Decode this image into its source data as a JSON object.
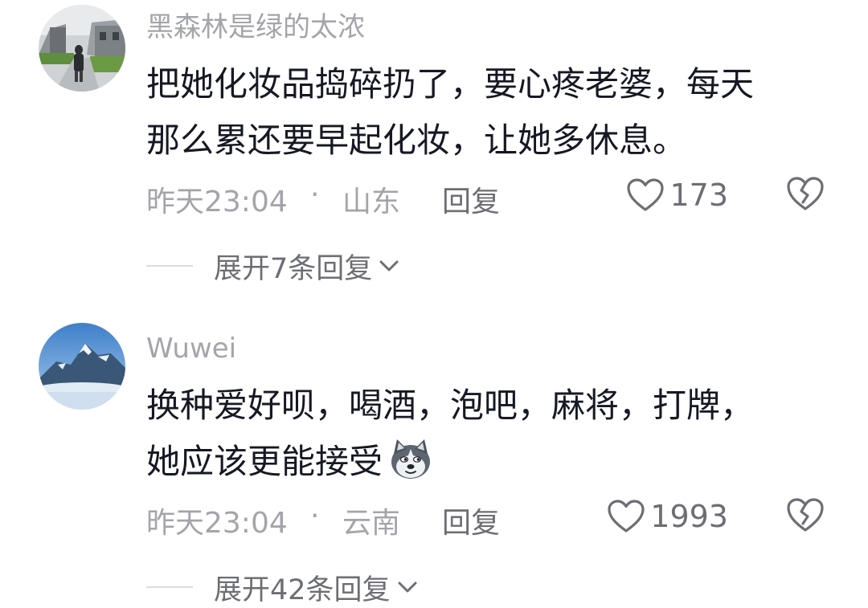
{
  "comments": [
    {
      "username": "黑森林是绿的太浓",
      "lines": [
        "把她化妆品捣碎扔了，要心疼老婆，每天",
        "那么累还要早起化妆，让她多休息。"
      ],
      "time": "昨天23:04",
      "separator": "·",
      "region": "山东",
      "reply_label": "回复",
      "likes": "173",
      "expand_label": "展开7条回复",
      "avatar": "person-on-path-photo"
    },
    {
      "username": "Wuwei",
      "lines": [
        "换种爱好呗，喝酒，泡吧，麻将，打牌，",
        "她应该更能接受"
      ],
      "emoji": "husky-dog-emoji",
      "time": "昨天23:04",
      "separator": "·",
      "region": "云南",
      "reply_label": "回复",
      "likes": "1993",
      "expand_label": "展开42条回复",
      "avatar": "snowy-mountain-photo"
    }
  ],
  "icons": {
    "like": "heart-outline-icon",
    "dislike": "broken-heart-icon",
    "expand": "chevron-down-icon"
  },
  "colors": {
    "text_primary": "#161823",
    "text_secondary": "#a4a5aa",
    "action_text": "#6d6e74",
    "divider": "#dcdcde"
  }
}
